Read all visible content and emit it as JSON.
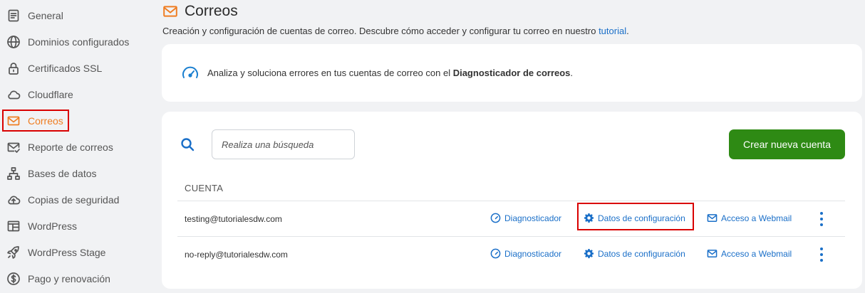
{
  "sidebar": {
    "items": [
      {
        "label": "General",
        "icon": "document-icon"
      },
      {
        "label": "Dominios configurados",
        "icon": "globe-icon"
      },
      {
        "label": "Certificados SSL",
        "icon": "lock-icon"
      },
      {
        "label": "Cloudflare",
        "icon": "cloud-icon"
      },
      {
        "label": "Correos",
        "icon": "mail-icon",
        "active": true
      },
      {
        "label": "Reporte de correos",
        "icon": "mail-check-icon"
      },
      {
        "label": "Bases de datos",
        "icon": "database-tree-icon"
      },
      {
        "label": "Copias de seguridad",
        "icon": "cloud-upload-icon"
      },
      {
        "label": "WordPress",
        "icon": "layout-icon"
      },
      {
        "label": "WordPress Stage",
        "icon": "rocket-icon"
      },
      {
        "label": "Pago y renovación",
        "icon": "dollar-circle-icon"
      }
    ]
  },
  "header": {
    "title": "Correos",
    "subtitle_text": "Creación y configuración de cuentas de correo. Descubre cómo acceder y configurar tu correo en nuestro ",
    "subtitle_link": "tutorial",
    "subtitle_end": "."
  },
  "diagnostic_banner": {
    "text_before": "Analiza y soluciona errores en tus cuentas de correo con el ",
    "text_bold": "Diagnosticador de correos",
    "text_after": "."
  },
  "accounts": {
    "search_placeholder": "Realiza una búsqueda",
    "create_button": "Crear nueva cuenta",
    "column_header": "CUENTA",
    "rows": [
      {
        "email": "testing@tutorialesdw.com",
        "diag": "Diagnosticador",
        "config": "Datos de configuración",
        "webmail": "Acceso a Webmail"
      },
      {
        "email": "no-reply@tutorialesdw.com",
        "diag": "Diagnosticador",
        "config": "Datos de configuración",
        "webmail": "Acceso a Webmail"
      }
    ]
  },
  "colors": {
    "accent_orange": "#ef7d22",
    "link_blue": "#1a6fc8",
    "create_green": "#2e8a14",
    "highlight_red": "#d90000"
  }
}
